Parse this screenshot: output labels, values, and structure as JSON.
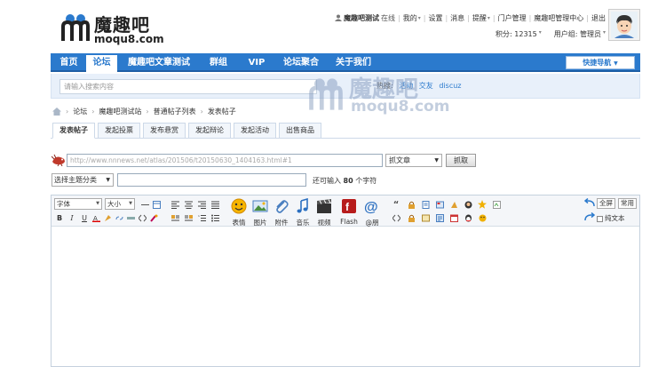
{
  "brand": {
    "name_cn": "魔趣吧",
    "domain": "moqu8.com"
  },
  "userbar": {
    "username": "魔趣吧测试",
    "status": "在线",
    "links": [
      "我的",
      "设置",
      "消息",
      "提醒",
      "门户管理",
      "魔趣吧管理中心",
      "退出"
    ],
    "points": "积分: 12315",
    "usergroup": "用户组: 管理员"
  },
  "nav": {
    "items": [
      "首页",
      "论坛",
      "魔趣吧文章测试",
      "群组",
      "VIP",
      "论坛聚合",
      "关于我们"
    ],
    "active_index": 1,
    "quick_nav": "快捷导航"
  },
  "search": {
    "placeholder": "请输入搜索内容",
    "hot_label": "热搜:",
    "hot_words": [
      "活动",
      "交友",
      "discuz"
    ]
  },
  "watermark": {
    "cn": "魔趣吧",
    "en": "moqu8.com"
  },
  "breadcrumb": [
    "论坛",
    "魔趣吧测试站",
    "普通帖子列表",
    "发表帖子"
  ],
  "tabs": [
    "发表帖子",
    "发起投票",
    "发布悬赏",
    "发起辩论",
    "发起活动",
    "出售商品"
  ],
  "grab": {
    "url": "http://www.nnnews.net/atlas/201506/t20150630_1404163.html#1",
    "type": "抓文章",
    "button": "抓取"
  },
  "title_row": {
    "topic_select": "选择主题分类",
    "hint_prefix": "还可输入",
    "hint_count": "80",
    "hint_suffix": "个字符"
  },
  "editor": {
    "font": "字体",
    "size": "大小",
    "media_buttons": [
      "表情",
      "图片",
      "附件",
      "音乐",
      "视频",
      "Flash",
      "@朋"
    ],
    "fullscreen": "全屏",
    "common": "常用",
    "plaintext": "纯文本"
  },
  "colors": {
    "nav_blue": "#2b7acd",
    "search_bg": "#e8f0fa"
  }
}
